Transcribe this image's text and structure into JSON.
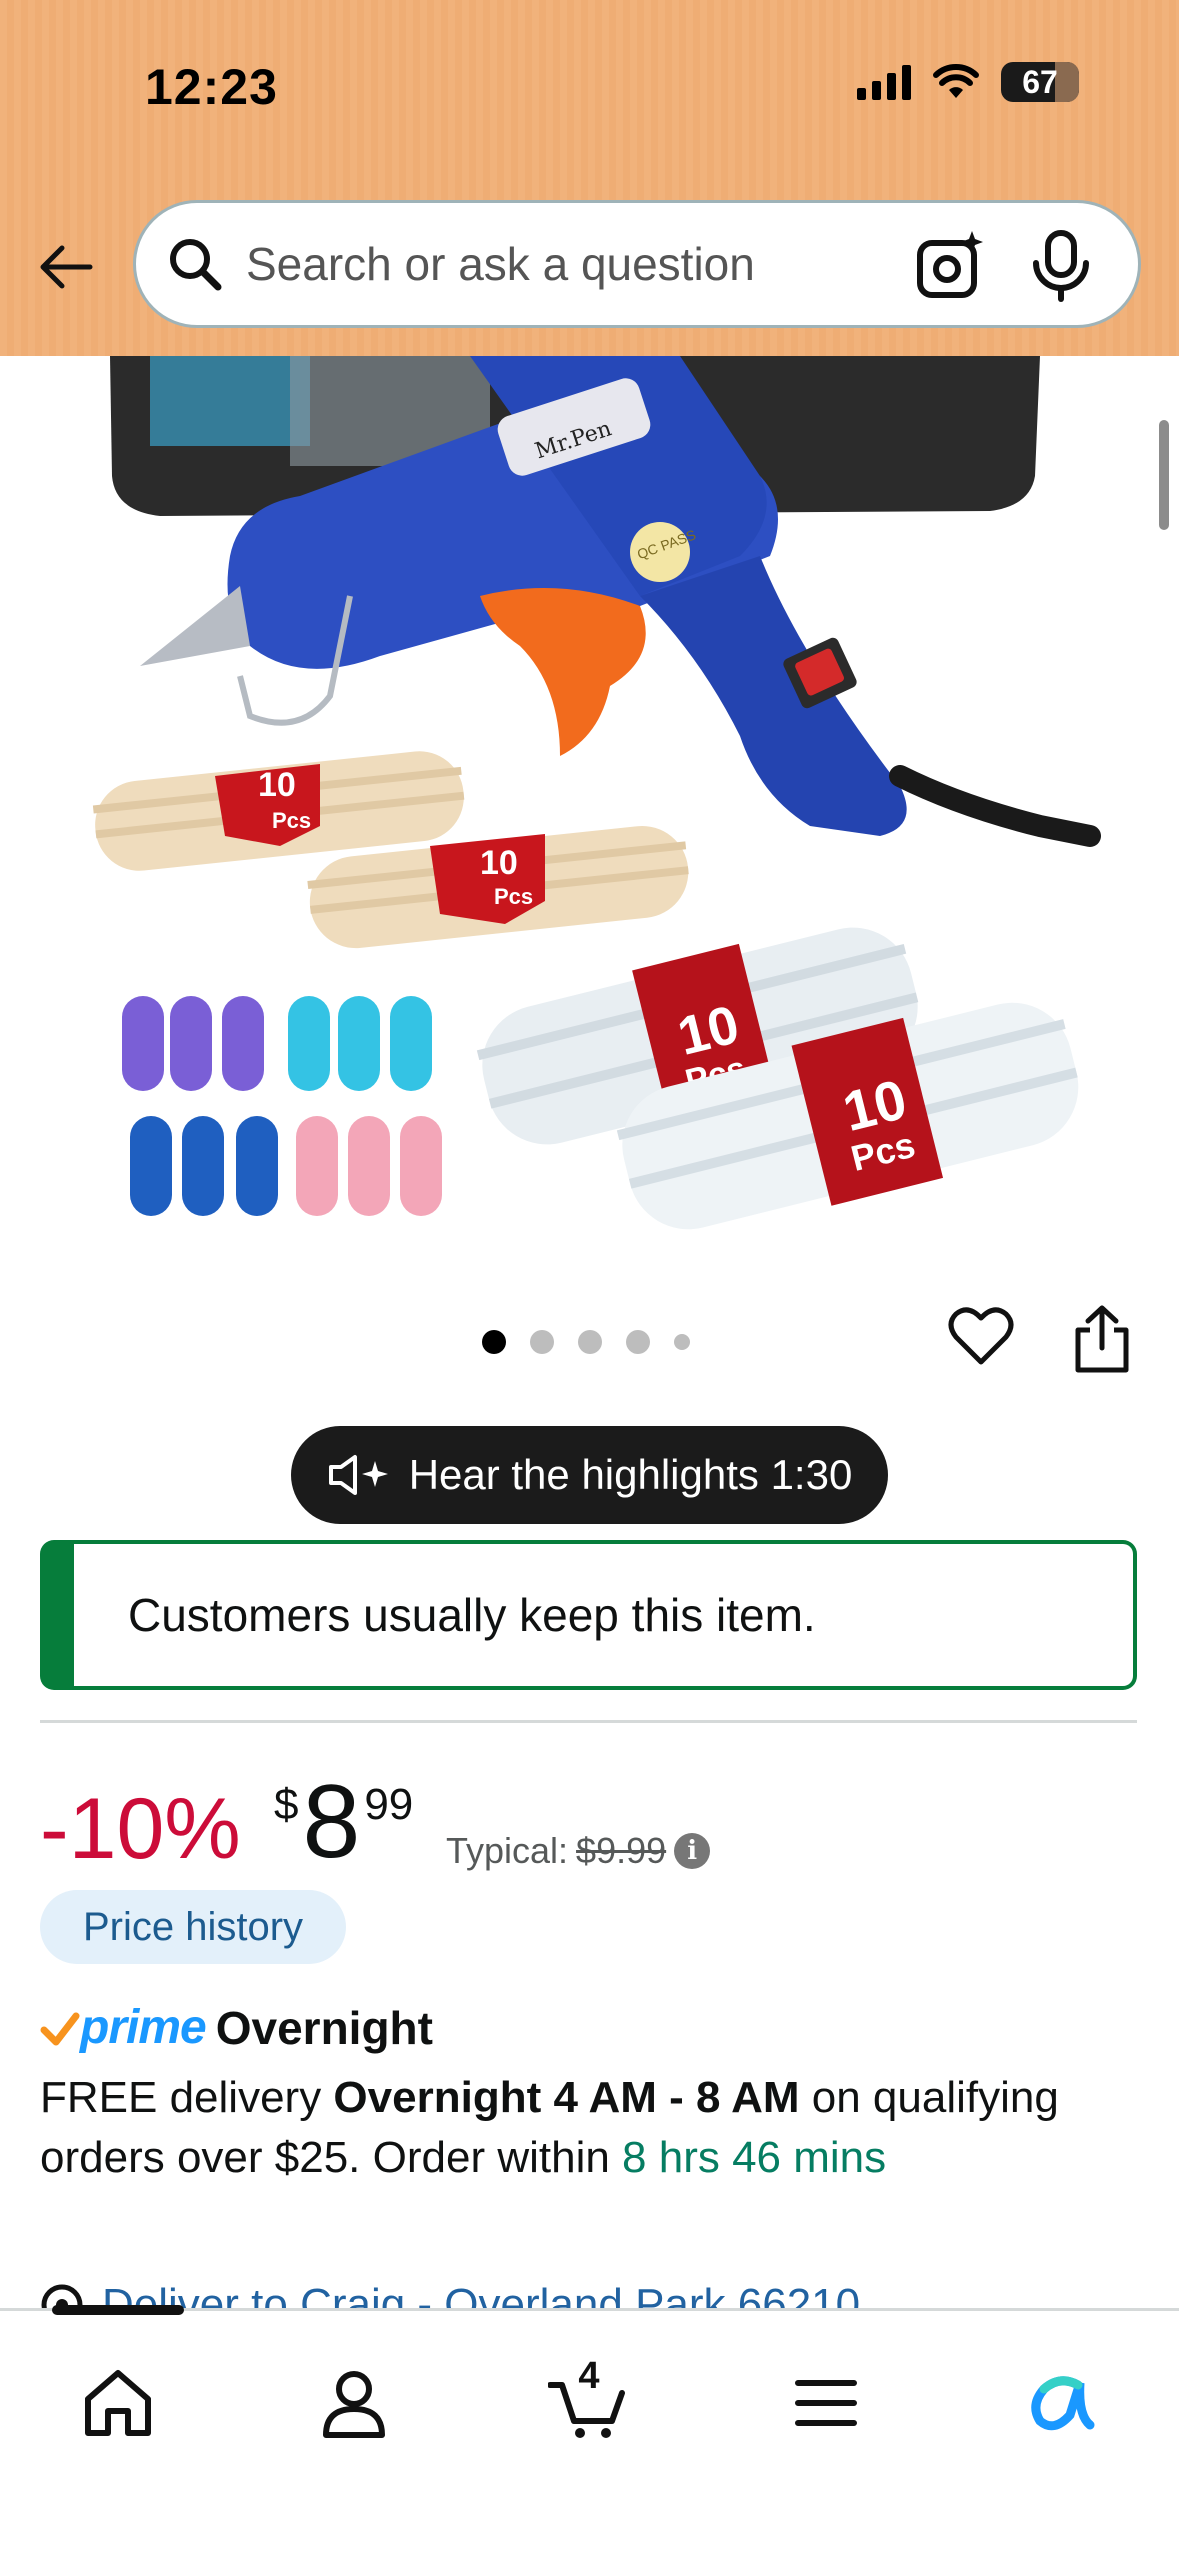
{
  "status_bar": {
    "time": "12:23",
    "battery": "67"
  },
  "search": {
    "placeholder": "Search or ask a question"
  },
  "product_image": {
    "label_pcs": "Pcs",
    "label_count": "10",
    "brand_text": "Mr.Pen",
    "qc_text": "QC PASS",
    "carousel_count": 5,
    "carousel_active": 1
  },
  "hear_highlights": {
    "label": "Hear the highlights 1:30"
  },
  "keep_notice": {
    "text": "Customers usually keep this item."
  },
  "pricing": {
    "discount": "-10%",
    "currency_symbol": "$",
    "price_whole": "8",
    "price_cents": "99",
    "typical_label": "Typical:",
    "typical_price": "$9.99",
    "price_history_label": "Price history"
  },
  "delivery": {
    "prime_label": "prime",
    "prime_speed": "Overnight",
    "line_prefix": "FREE delivery ",
    "window": "Overnight 4 AM - 8 AM",
    "line_middle": " on qualifying orders over $25. Order within ",
    "countdown": "8 hrs 46 mins",
    "deliver_to": "Deliver to Craig - Overland Park 66210"
  },
  "tabbar": {
    "cart_count": "4"
  },
  "colors": {
    "header_bg": "#f1b27b",
    "discount_red": "#cc0c39",
    "keep_green": "#067d3b",
    "countdown_green": "#067d62",
    "link_blue": "#2162a1",
    "prime_blue": "#1a98ff"
  },
  "icons": [
    "back-arrow-icon",
    "search-icon",
    "camera-icon",
    "mic-icon",
    "heart-icon",
    "share-icon",
    "speaker-sparkle-icon",
    "info-icon",
    "location-icon",
    "home-icon",
    "profile-icon",
    "cart-icon",
    "menu-icon",
    "rufus-icon"
  ]
}
